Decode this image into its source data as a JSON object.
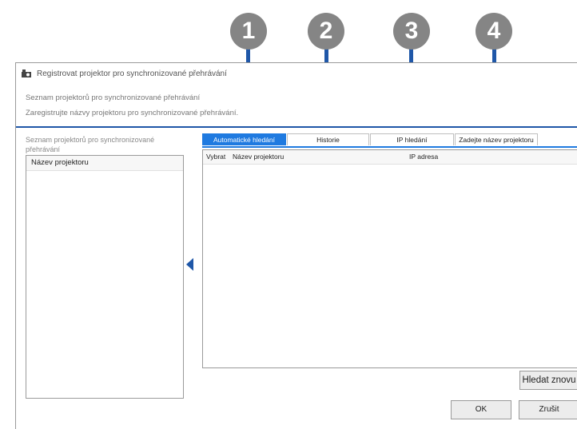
{
  "callouts": [
    "1",
    "2",
    "3",
    "4"
  ],
  "window": {
    "title": "Registrovat projektor pro synchronizované přehrávání",
    "icon": "projector-app-icon"
  },
  "info": {
    "line1": "Seznam projektorů pro synchronizované přehrávání",
    "line2": "Zaregistrujte názvy projektoru pro synchronizované přehrávání."
  },
  "left": {
    "heading": "Seznam projektorů pro synchronizované přehrávání",
    "column_header": "Název projektoru"
  },
  "tabs": [
    {
      "label": "Automatické hledání",
      "active": true
    },
    {
      "label": "Historie",
      "active": false
    },
    {
      "label": "IP hledání",
      "active": false
    },
    {
      "label": "Zadejte název projektoru",
      "active": false
    }
  ],
  "results": {
    "col_select": "Vybrat",
    "col_name": "Název projektoru",
    "col_ip": "IP adresa"
  },
  "buttons": {
    "search": "Hledat znovu",
    "ok": "OK",
    "cancel": "Zrušit"
  },
  "colors": {
    "accent": "#1f57a8",
    "tab_active": "#1f7ae0",
    "callout": "#858585"
  }
}
